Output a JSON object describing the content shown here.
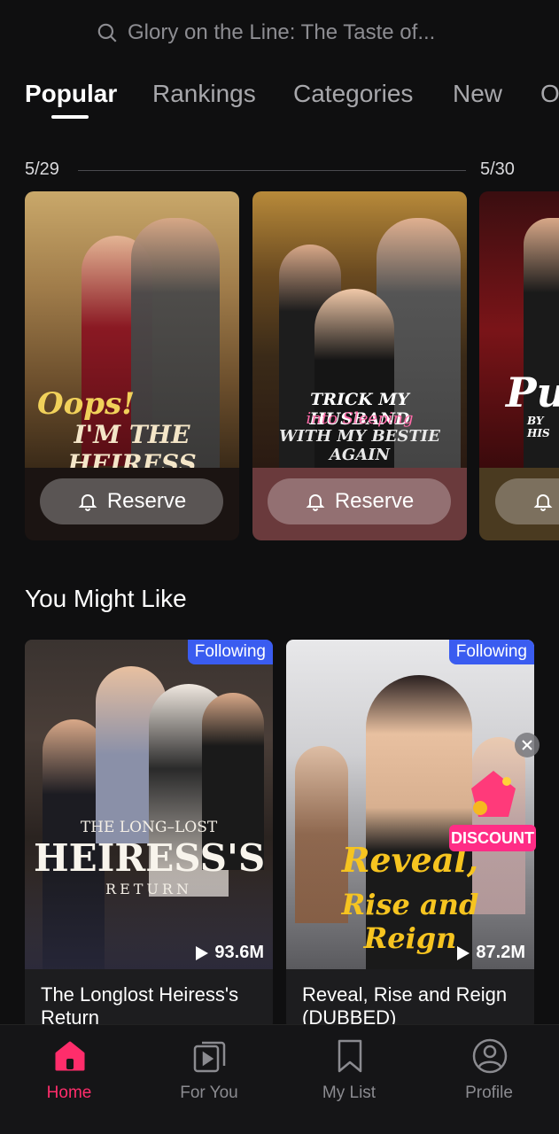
{
  "search": {
    "placeholder": "Glory on the Line: The Taste of..."
  },
  "tabs": [
    {
      "label": "Popular",
      "active": true
    },
    {
      "label": "Rankings",
      "active": false
    },
    {
      "label": "Categories",
      "active": false
    },
    {
      "label": "New",
      "active": false
    },
    {
      "label": "O",
      "active": false
    }
  ],
  "timeline": {
    "date_1": "5/29",
    "date_2": "5/30"
  },
  "reserve_cards": [
    {
      "poster_title_1": "Oops!",
      "poster_title_2": "I'M THE HEIRESS",
      "button": "Reserve"
    },
    {
      "poster_title_1": "TRICK MY HUSBAND",
      "poster_title_2": "into Sleeping",
      "poster_title_3": "WITH MY BESTIE AGAIN",
      "button": "Reserve"
    },
    {
      "poster_title_1": "Pu",
      "poster_title_2": "BY HIS"
    }
  ],
  "section": {
    "title": "You Might Like"
  },
  "shows": [
    {
      "badge": "Following",
      "poster_title_1": "THE LONG–LOST",
      "poster_title_2": "HEIRESS'S",
      "poster_title_3": "RETURN",
      "views": "93.6M",
      "title": "The Longlost Heiress's Return"
    },
    {
      "badge": "Following",
      "poster_title_1": "Reveal,",
      "poster_title_2": "Rise and Reign",
      "views": "87.2M",
      "title": "Reveal, Rise and Reign (DUBBED)"
    }
  ],
  "promo": {
    "discount": "DISCOUNT"
  },
  "nav": [
    {
      "label": "Home",
      "icon": "home-icon",
      "active": true
    },
    {
      "label": "For You",
      "icon": "play-stack-icon",
      "active": false
    },
    {
      "label": "My List",
      "icon": "bookmark-icon",
      "active": false
    },
    {
      "label": "Profile",
      "icon": "profile-icon",
      "active": false
    }
  ],
  "colors": {
    "accent": "#ff2d6b",
    "badge": "#3a5cf0",
    "discount": "#ff2d86",
    "background": "#0f0f10"
  }
}
